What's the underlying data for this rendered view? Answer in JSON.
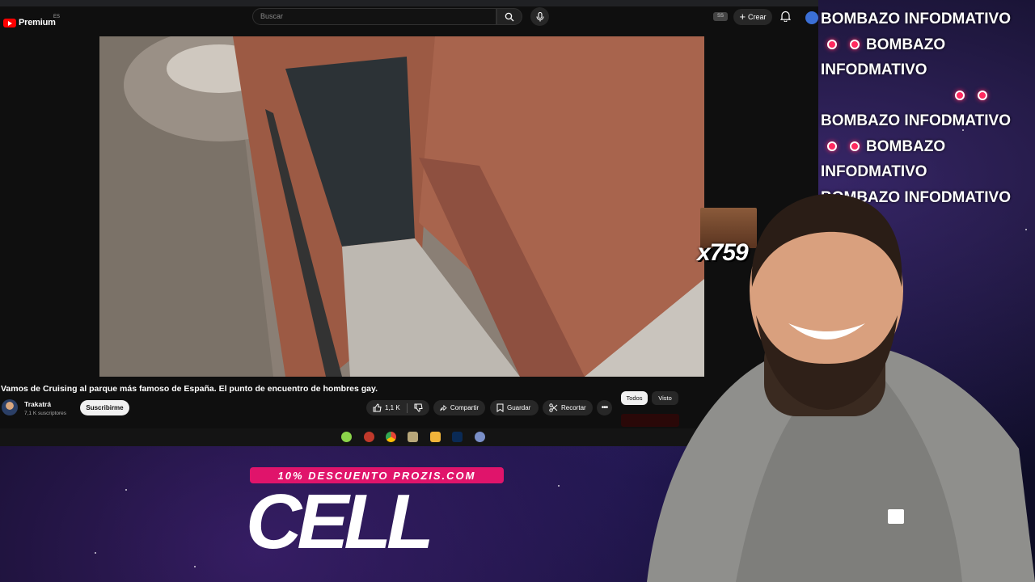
{
  "youtube": {
    "logo_text": "Premium",
    "country_code": "ES",
    "search_placeholder": "Buscar",
    "header_badge": "SS",
    "create_label": "Crear",
    "video": {
      "title": "Vamos de Cruising al parque más famoso de España. El punto de encuentro de hombres gay.",
      "channel_name": "Trakatrá",
      "subscribers": "7,1 K suscriptores",
      "subscribe_label": "Suscribirme",
      "likes": "1,1 K",
      "share_label": "Compartir",
      "save_label": "Guardar",
      "clip_label": "Recortar"
    },
    "filter_chips": [
      "Todos",
      "Visto"
    ]
  },
  "overlay": {
    "emote_multiplier": "x759",
    "ticker_text": "BOMBAZO INFODMATIVO",
    "promo_text": "10% DESCUENTO PROZIS.COM",
    "brand_text": "CELL"
  },
  "colors": {
    "accent_red": "#ff0000",
    "promo_pink": "#e0146b",
    "ticker_dot": "#ff2a5f"
  }
}
